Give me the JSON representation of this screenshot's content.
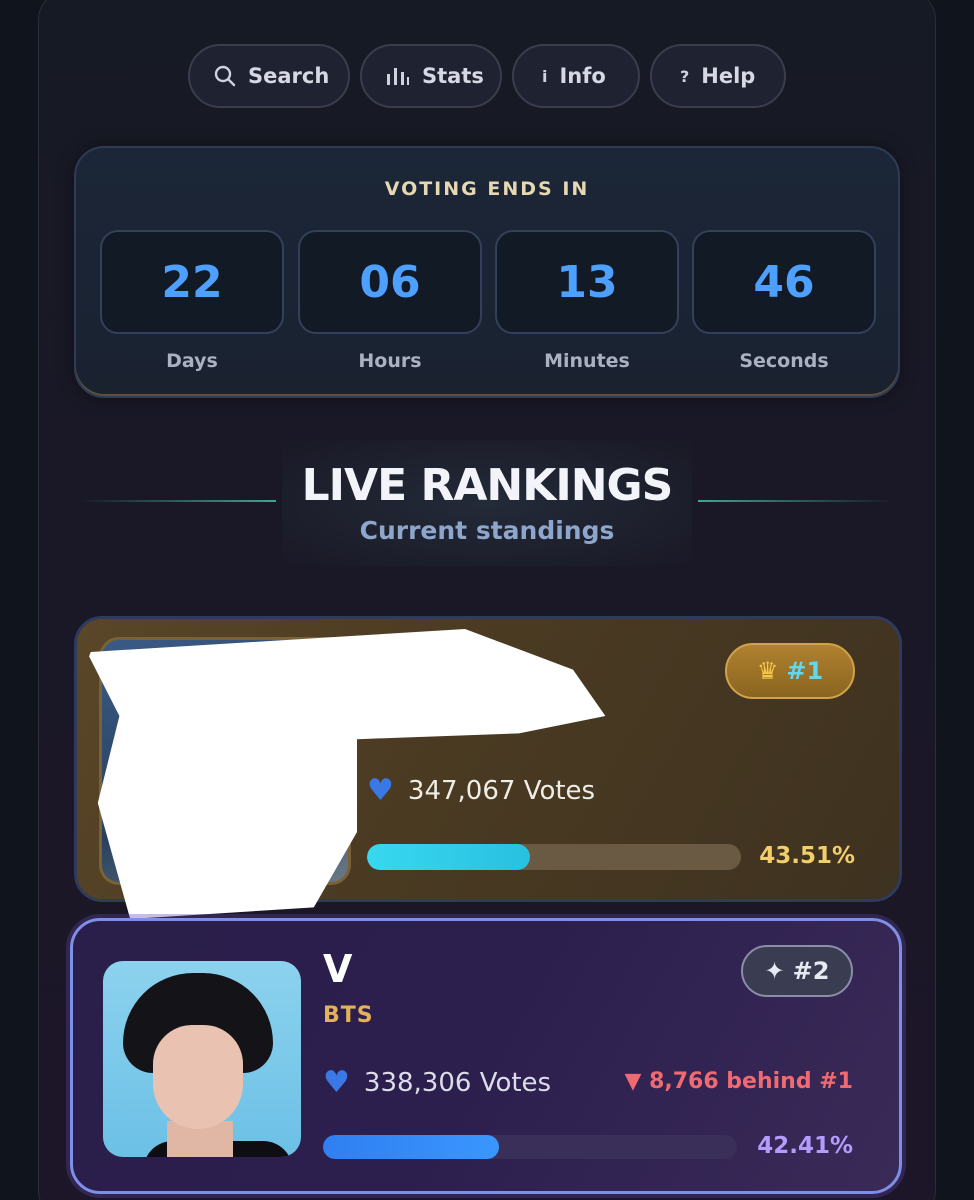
{
  "nav": {
    "search_label": "Search",
    "stats_label": "Stats",
    "info_label": "Info",
    "help_label": "Help"
  },
  "countdown": {
    "title": "VOTING ENDS IN",
    "days": "22",
    "days_label": "Days",
    "hours": "06",
    "hours_label": "Hours",
    "minutes": "13",
    "minutes_label": "Minutes",
    "seconds": "46",
    "seconds_label": "Seconds"
  },
  "rankings": {
    "title": "LIVE RANKINGS",
    "subtitle": "Current standings"
  },
  "entries": [
    {
      "rank_label": "#1",
      "votes": "347,067 Votes",
      "percent_text": "43.51%",
      "share": 0.4351
    },
    {
      "name": "V",
      "group": "BTS",
      "rank_label": "#2",
      "votes": "338,306 Votes",
      "behind": "▼ 8,766 behind #1",
      "percent_text": "42.41%",
      "share": 0.4241
    }
  ],
  "colors": {
    "accent_blue": "#4ea0ff",
    "gold": "#f3cf6b",
    "behind_red": "#f06a72",
    "purple_pct": "#b49cff"
  }
}
